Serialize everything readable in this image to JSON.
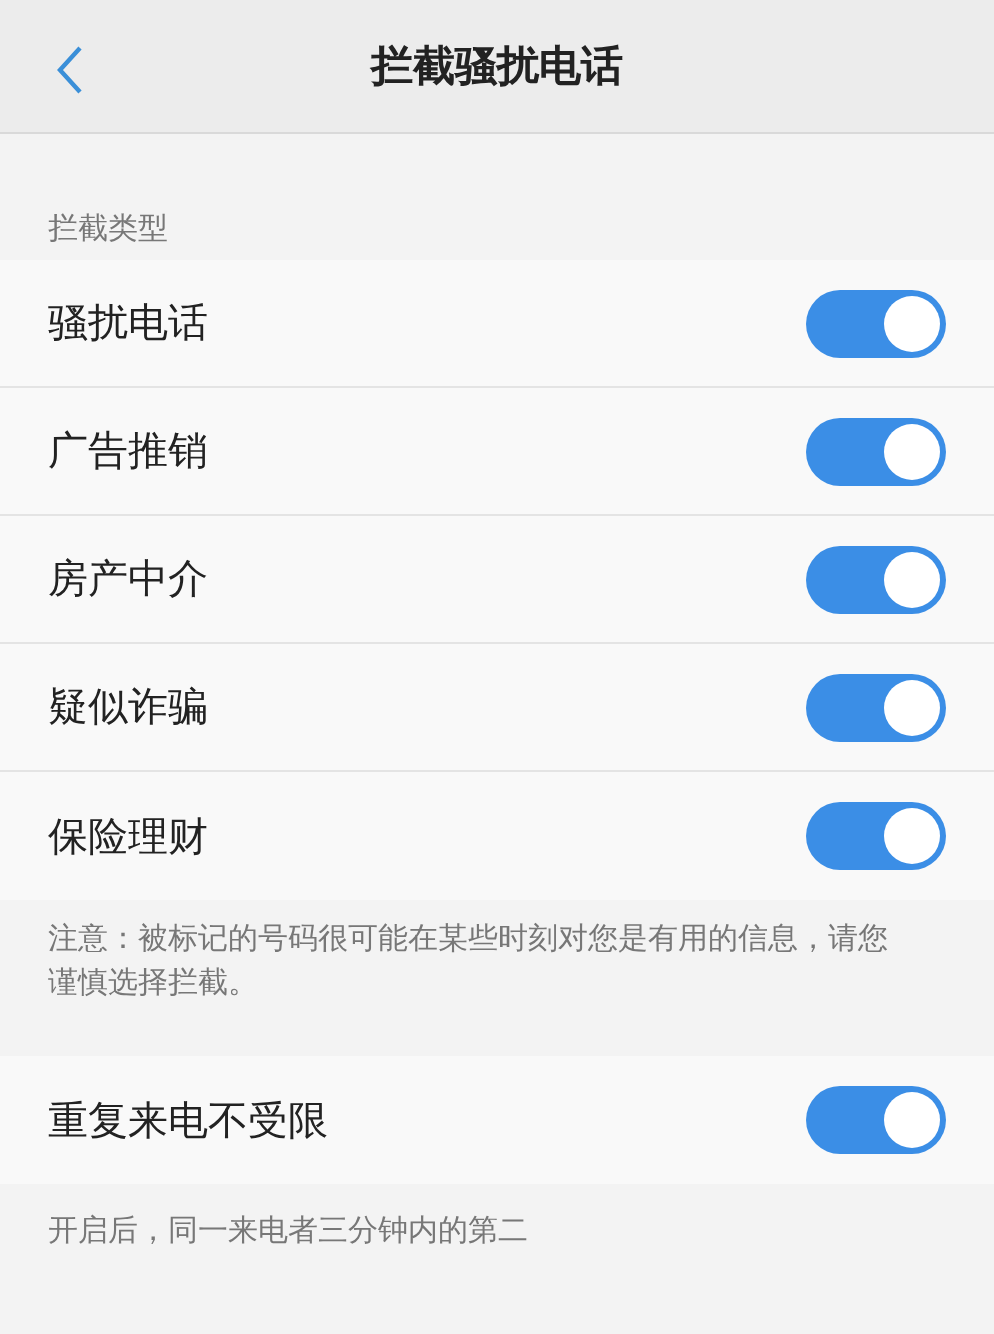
{
  "header": {
    "title": "拦截骚扰电话"
  },
  "section_label": "拦截类型",
  "types": [
    {
      "label": "骚扰电话",
      "on": true
    },
    {
      "label": "广告推销",
      "on": true
    },
    {
      "label": "房产中介",
      "on": true
    },
    {
      "label": "疑似诈骗",
      "on": true
    },
    {
      "label": "保险理财",
      "on": true
    }
  ],
  "note": "注意：被标记的号码很可能在某些时刻对您是有用的信息，请您谨慎选择拦截。",
  "repeat_call": {
    "label": "重复来电不受限",
    "on": true
  },
  "repeat_note": "开启后，同一来电者三分钟内的第二"
}
